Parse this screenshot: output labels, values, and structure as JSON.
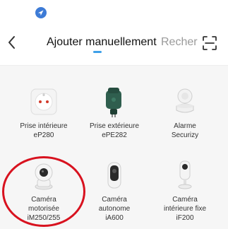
{
  "header": {
    "back_icon": "chevron-left-icon",
    "location_icon": "location-arrow-icon",
    "scan_icon": "scan-frame-icon",
    "tabs": [
      {
        "label": "Ajouter manuellement",
        "active": true
      },
      {
        "label": "Recher",
        "active": false
      }
    ],
    "accent_color": "#3ea0e8"
  },
  "devices": [
    {
      "line1": "Prise intérieure",
      "line2": "eP280",
      "line3": ""
    },
    {
      "line1": "Prise extérieure",
      "line2": "ePE282",
      "line3": ""
    },
    {
      "line1": "Alarme",
      "line2": "Securizy",
      "line3": ""
    },
    {
      "line1": "Caméra",
      "line2": "motorisée",
      "line3": "iM250/255"
    },
    {
      "line1": "Caméra",
      "line2": "autonome",
      "line3": "iA600"
    },
    {
      "line1": "Caméra",
      "line2": "intérieure fixe",
      "line3": "iF200"
    }
  ],
  "highlight": {
    "color": "#d8121f",
    "target": "Caméra motorisée iM250/255"
  }
}
